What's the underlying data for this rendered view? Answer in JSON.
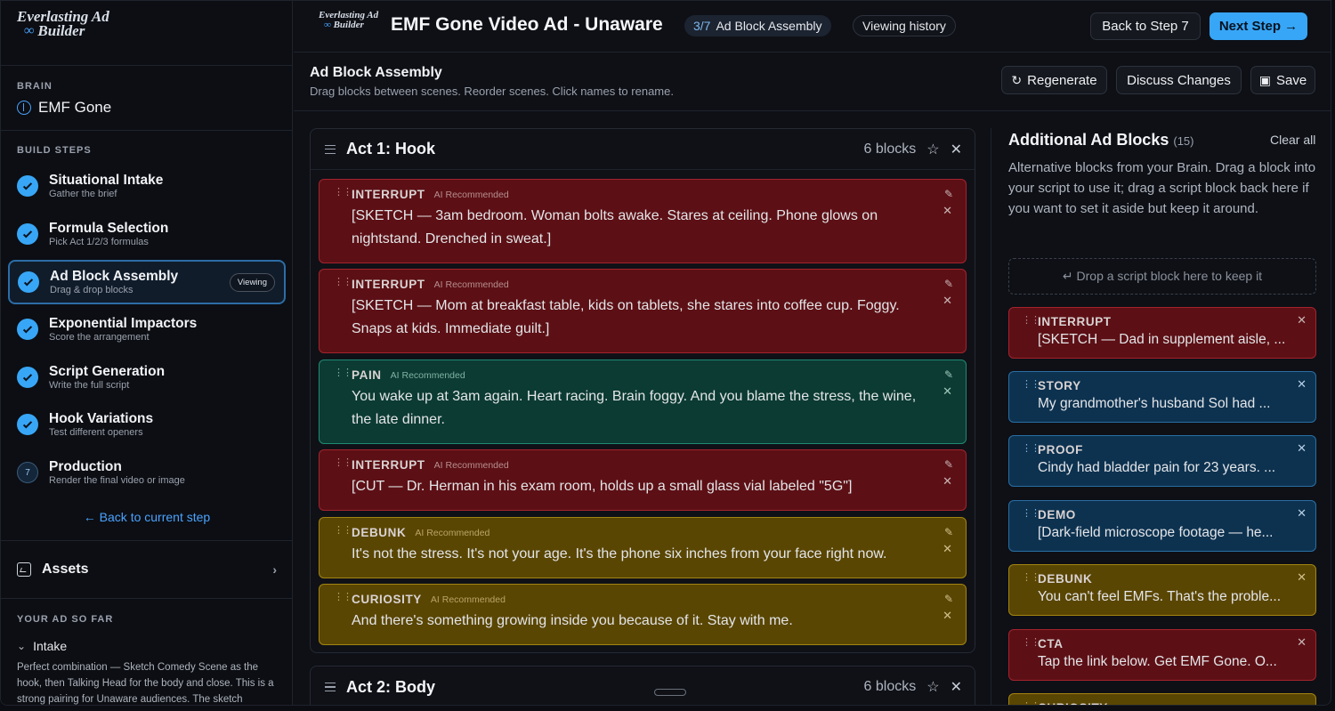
{
  "sidebar": {
    "logo_line1": "Everlasting Ad",
    "logo_line2": "Builder",
    "brain_label": "BRAIN",
    "brain_name": "EMF Gone",
    "build_steps_label": "BUILD STEPS",
    "steps": [
      {
        "title": "Situational Intake",
        "subtitle": "Gather the brief"
      },
      {
        "title": "Formula Selection",
        "subtitle": "Pick Act 1/2/3 formulas"
      },
      {
        "title": "Ad Block Assembly",
        "subtitle": "Drag & drop blocks",
        "badge": "Viewing"
      },
      {
        "title": "Exponential Impactors",
        "subtitle": "Score the arrangement"
      },
      {
        "title": "Script Generation",
        "subtitle": "Write the full script"
      },
      {
        "title": "Hook Variations",
        "subtitle": "Test different openers"
      },
      {
        "title": "Production",
        "subtitle": "Render the final video or image",
        "number": "7"
      }
    ],
    "back_link": "← Back to current step",
    "assets_label": "Assets",
    "your_ad_label": "YOUR AD SO FAR",
    "intake_label": "Intake",
    "intake_text": "Perfect combination — Sketch Comedy Scene as the hook, then Talking Head for the body and close. This is a strong pairing for Unaware audiences. The sketch"
  },
  "header": {
    "logo_line1": "Everlasting Ad",
    "logo_line2": "Builder",
    "title": "EMF Gone Video Ad - Unaware",
    "step_fraction": "3/7",
    "step_name": "Ad Block Assembly",
    "history_label": "Viewing history",
    "back_button": "Back to Step 7",
    "next_button": "Next Step →"
  },
  "subheader": {
    "title": "Ad Block Assembly",
    "description": "Drag blocks between scenes. Reorder scenes. Click names to rename.",
    "regenerate": "Regenerate",
    "discuss": "Discuss Changes",
    "save": "Save"
  },
  "acts": [
    {
      "name": "Act 1: Hook",
      "count": "6 blocks",
      "blocks": [
        {
          "type": "INTERRUPT",
          "tag": "AI Recommended",
          "color": "red",
          "text": "[SKETCH — 3am bedroom. Woman bolts awake. Stares at ceiling. Phone glows on nightstand. Drenched in sweat.]"
        },
        {
          "type": "INTERRUPT",
          "tag": "AI Recommended",
          "color": "red",
          "text": "[SKETCH — Mom at breakfast table, kids on tablets, she stares into coffee cup. Foggy. Snaps at kids. Immediate guilt.]"
        },
        {
          "type": "PAIN",
          "tag": "AI Recommended",
          "color": "teal",
          "text": "You wake up at 3am again. Heart racing. Brain foggy. And you blame the stress, the wine, the late dinner."
        },
        {
          "type": "INTERRUPT",
          "tag": "AI Recommended",
          "color": "red",
          "text": "[CUT — Dr. Herman in his exam room, holds up a small glass vial labeled \"5G\"]"
        },
        {
          "type": "DEBUNK",
          "tag": "AI Recommended",
          "color": "yellow",
          "text": "It's not the stress. It's not your age. It's the phone six inches from your face right now."
        },
        {
          "type": "CURIOSITY",
          "tag": "AI Recommended",
          "color": "yellow",
          "text": "And there's something growing inside you because of it. Stay with me."
        }
      ]
    },
    {
      "name": "Act 2: Body",
      "count": "6 blocks"
    }
  ],
  "right_panel": {
    "title": "Additional Ad Blocks",
    "count": "(15)",
    "clear_all": "Clear all",
    "description": "Alternative blocks from your Brain. Drag a block into your script to use it; drag a script block back here if you want to set it aside but keep it around.",
    "dropzone": "↵ Drop a script block here to keep it",
    "blocks": [
      {
        "type": "INTERRUPT",
        "color": "red",
        "text": "[SKETCH — Dad in supplement aisle, ..."
      },
      {
        "type": "STORY",
        "color": "blue",
        "text": "My grandmother's husband Sol had ..."
      },
      {
        "type": "PROOF",
        "color": "blue",
        "text": "Cindy had bladder pain for 23 years. ..."
      },
      {
        "type": "DEMO",
        "color": "blue",
        "text": "[Dark-field microscope footage — he..."
      },
      {
        "type": "DEBUNK",
        "color": "yellow",
        "text": "You can't feel EMFs. That's the proble..."
      },
      {
        "type": "CTA",
        "color": "red",
        "text": "Tap the link below. Get EMF Gone. O..."
      },
      {
        "type": "CURIOSITY",
        "color": "yellow",
        "text": ""
      }
    ]
  },
  "colors": {
    "accent": "#38a6f6",
    "red_block": "#5c1015",
    "teal_block": "#0c3b33",
    "yellow_block": "#5a4603",
    "blue_block": "#0d3250"
  }
}
